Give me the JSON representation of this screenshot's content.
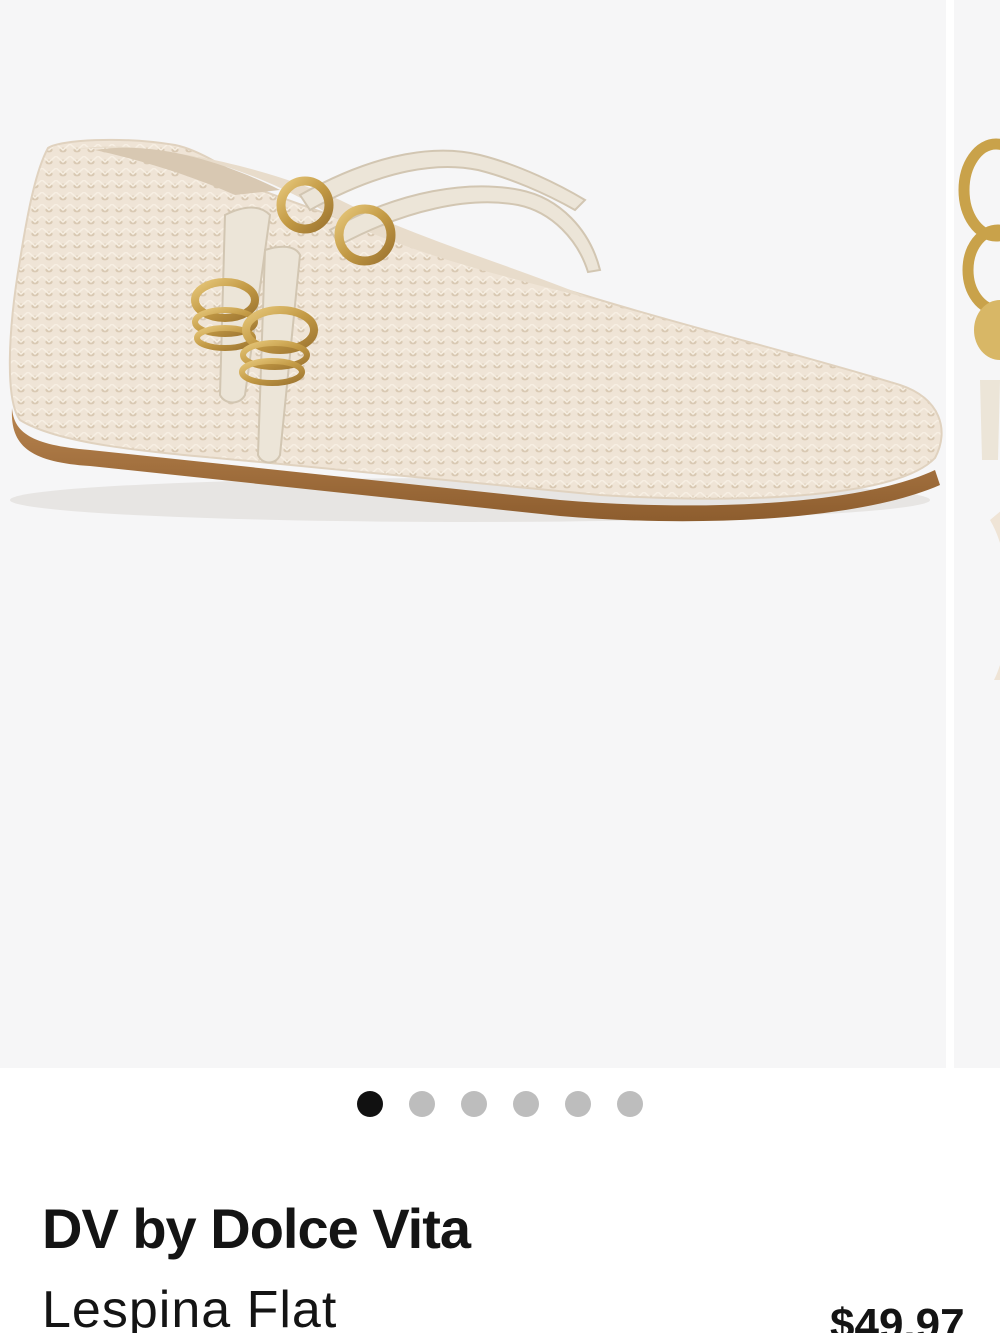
{
  "gallery": {
    "main_image_alt": "Cream crochet mary jane flat with double straps and gold ring hardware",
    "next_image_alt": "Close-up of gold ring hardware",
    "slide_count": 6,
    "active_index": 0,
    "background_color": "#f6f6f7"
  },
  "product": {
    "brand": "DV by Dolce Vita",
    "name": "Lespina Flat",
    "price": "$49.97"
  },
  "colors": {
    "dot_active": "#111111",
    "dot_inactive": "#bdbdbd",
    "shoe_knit": "#efe4d6",
    "strap": "#ece5d8",
    "hardware_gold": "#c9a24a",
    "sole": "#a8743f"
  }
}
